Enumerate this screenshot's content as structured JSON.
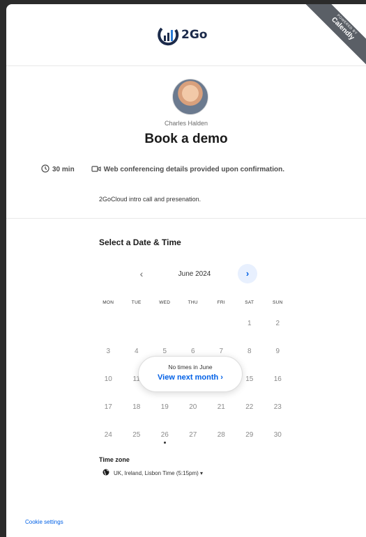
{
  "header": {
    "logo_text": "2Go",
    "ribbon_small": "POWERED BY",
    "ribbon_big": "Calendly"
  },
  "event": {
    "host": "Charles Halden",
    "title": "Book a demo",
    "duration": "30 min",
    "location": "Web conferencing details provided upon confirmation.",
    "description": "2GoCloud intro call and presenation."
  },
  "calendar": {
    "section_title": "Select a Date & Time",
    "month_label": "June 2024",
    "prev_glyph": "‹",
    "next_glyph": "›",
    "weekdays": [
      "MON",
      "TUE",
      "WED",
      "THU",
      "FRI",
      "SAT",
      "SUN"
    ],
    "weeks": [
      [
        "",
        "",
        "",
        "",
        "",
        "1",
        "2"
      ],
      [
        "3",
        "4",
        "5",
        "6",
        "7",
        "8",
        "9"
      ],
      [
        "10",
        "11",
        "",
        "",
        "",
        "15",
        "16"
      ],
      [
        "17",
        "18",
        "19",
        "20",
        "21",
        "22",
        "23"
      ],
      [
        "24",
        "25",
        "26",
        "27",
        "28",
        "29",
        "30"
      ]
    ],
    "popup_line1": "No times in June",
    "popup_line2": "View next month  ›"
  },
  "timezone": {
    "label": "Time zone",
    "value": "UK, Ireland, Lisbon Time (5:15pm) ▾"
  },
  "footer": {
    "cookie": "Cookie settings"
  },
  "colors": {
    "accent": "#0060e6",
    "ribbon": "#5a5f66"
  }
}
